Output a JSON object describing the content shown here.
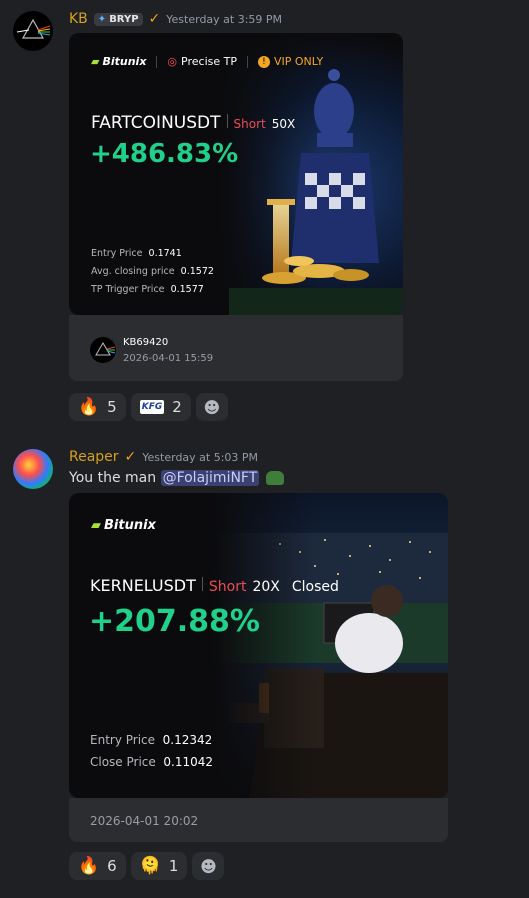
{
  "messages": [
    {
      "author": "KB",
      "tag": "BRYP",
      "timestamp": "Yesterday at 3:59 PM",
      "card": {
        "brand": "Bitunix",
        "badge1": "Precise TP",
        "badge2": "VIP ONLY",
        "pair": "FARTCOINUSDT",
        "side": "Short",
        "leverage": "50X",
        "pnl": "+486.83%",
        "rows": [
          {
            "label": "Entry Price",
            "value": "0.1741"
          },
          {
            "label": "Avg. closing price",
            "value": "0.1572"
          },
          {
            "label": "TP Trigger Price",
            "value": "0.1577"
          }
        ]
      },
      "footer": {
        "user": "KB69420",
        "datetime": "2026-04-01 15:59"
      },
      "reactions": [
        {
          "emoji": "🔥",
          "count": "5"
        },
        {
          "emoji": "KFG",
          "count": "2"
        }
      ]
    },
    {
      "author": "Reaper",
      "timestamp": "Yesterday at 5:03 PM",
      "text_prefix": "You the man",
      "mention": "@FolajimiNFT",
      "card": {
        "brand": "Bitunix",
        "pair": "KERNELUSDT",
        "side": "Short",
        "leverage": "20X",
        "status": "Closed",
        "pnl": "+207.88%",
        "rows": [
          {
            "label": "Entry Price",
            "value": "0.12342"
          },
          {
            "label": "Close Price",
            "value": "0.11042"
          }
        ]
      },
      "footer": {
        "datetime": "2026-04-01 20:02"
      },
      "reactions": [
        {
          "emoji": "🔥",
          "count": "6"
        },
        {
          "emoji": "🫠",
          "count": "1"
        }
      ]
    }
  ],
  "colors": {
    "accent_name": "#d4a01e",
    "profit": "#1fd18b",
    "short": "#ef4c55",
    "vip": "#f5a623",
    "background": "#1f2024"
  }
}
